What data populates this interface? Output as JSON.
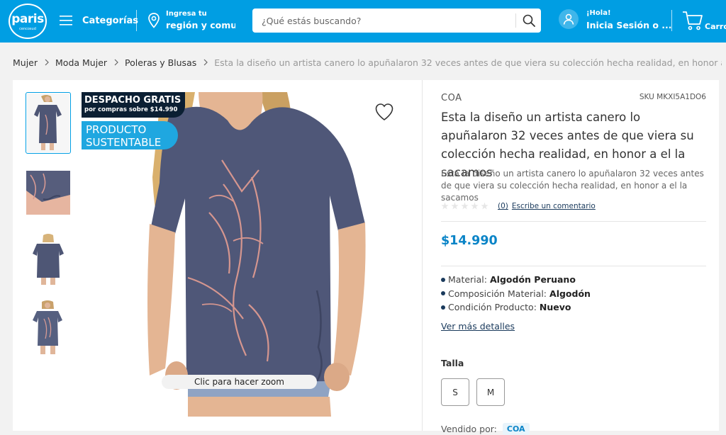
{
  "header": {
    "logo_text": "paris",
    "logo_sub": "cencosud",
    "categories_label": "Categorías",
    "region_line1": "Ingresa tu",
    "region_line2": "región y comuna",
    "search_placeholder": "¿Qué estás buscando?",
    "greeting": "¡Hola!",
    "login_label": "Inicia Sesión o ...",
    "cart_label": "Carro",
    "brand_color": "#009ee3"
  },
  "breadcrumb": {
    "items": [
      "Mujer",
      "Moda Mujer",
      "Poleras y Blusas"
    ],
    "current": "Esta la diseño un artista canero lo apuñalaron 32 veces antes de que viera su colección hecha realidad, en honor a el la sacamos"
  },
  "gallery": {
    "badge_shipping_title": "DESPACHO GRATIS",
    "badge_shipping_sub": "por compras sobre $14.990",
    "badge_sustainable_line1": "PRODUCTO",
    "badge_sustainable_line2": "SUSTENTABLE",
    "zoom_hint": "Clic para hacer zoom",
    "thumbnails": 4,
    "active_thumbnail": 1
  },
  "product": {
    "brand": "COA",
    "sku": "SKU MKXI5A1DO6",
    "title": "Esta la diseño un artista canero lo apuñalaron 32 veces antes de que viera su colección hecha realidad, en honor a el la sacamos",
    "description": "Esta la diseño un artista canero lo apuñalaron 32 veces antes de que viera su colección hecha realidad, en honor a el la sacamos",
    "rating_stars": 0,
    "review_count": "(0)",
    "write_review": "Escribe un comentario",
    "price": "$14.990",
    "price_color": "#0a84c7",
    "specs": [
      {
        "key": "Material:",
        "value": "Algodón Peruano"
      },
      {
        "key": "Composición Material:",
        "value": "Algodón"
      },
      {
        "key": "Condición Producto:",
        "value": "Nuevo"
      }
    ],
    "more_details": "Ver más detalles",
    "size_label": "Talla",
    "sizes": [
      "S",
      "M"
    ],
    "seller_label": "Vendido por:",
    "seller_name": "COA"
  }
}
